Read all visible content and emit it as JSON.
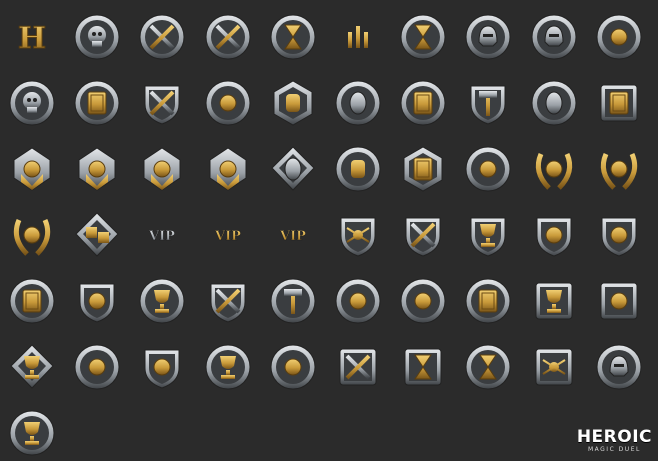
{
  "sheet": {
    "background": "#2b2b2b",
    "rows": [
      [
        "letter-h",
        "skull",
        "crossed-swords",
        "crossed-swords-wreath",
        "winged-hourglass",
        "candles",
        "hourglass",
        "armored-knight",
        "helmet",
        "crossbow"
      ],
      [
        "skulls",
        "cards",
        "shield-swords",
        "pharaoh",
        "hand-hexagon",
        "gems-pile",
        "card-pedestal",
        "hammer-shield",
        "crystal-egg",
        "card-square"
      ],
      [
        "rank-banner-bronze",
        "rank-banner-silver",
        "rank-banner-gold",
        "rank-banner-hex",
        "crown-crystal",
        "fist",
        "card-hexagon",
        "winged-scroll",
        "laurel-gold",
        "laurel-silver"
      ],
      [
        "laurel-dark",
        "dice",
        "vip-silver",
        "vip-crest",
        "vip-gold",
        "spider-shield",
        "crossed-blades-shield",
        "trophy-shield",
        "scroll-shield",
        "book-shield"
      ],
      [
        "card-trio",
        "beast-shield",
        "trophy-claws",
        "spear-shield",
        "hammer-axe",
        "warrior-figure",
        "warrior-ornate",
        "cards-gold",
        "trophy-frame",
        "army-wall"
      ],
      [
        "trophy-crown",
        "monk-statue",
        "torch-shield",
        "grail-winged",
        "dragon-heap",
        "scepters-frame",
        "hourglass-frame",
        "hourglass-ornate",
        "spider-frame",
        "spartan-helmet"
      ],
      [
        "trophy-laurel"
      ]
    ],
    "palette": {
      "gold": "#c99a3a",
      "gold_light": "#f1cf73",
      "gold_dark": "#7a5518",
      "silver": "#9aa0a6",
      "silver_light": "#e4e7ea",
      "steel_dark": "#3f4347"
    }
  },
  "logo": {
    "word": "HEROIC",
    "subtitle": "MAGIC DUEL"
  }
}
